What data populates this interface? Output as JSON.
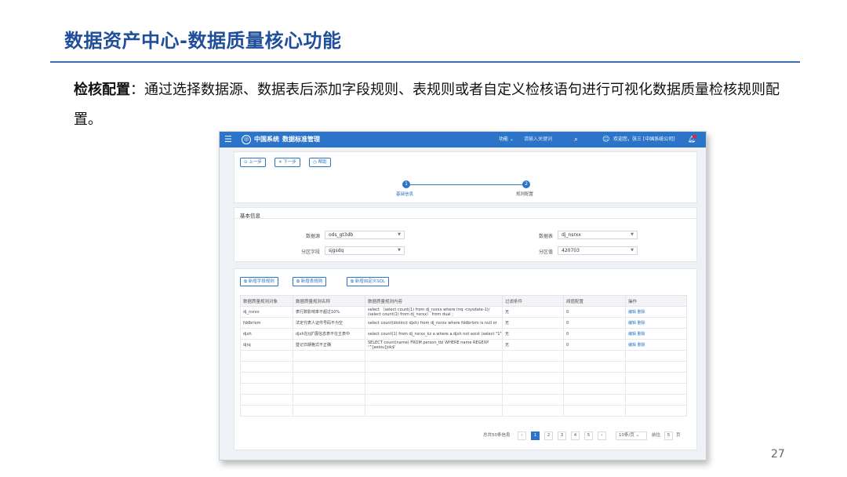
{
  "slide": {
    "title": "数据资产中心-数据质量核心功能",
    "desc_bold": "检核配置",
    "desc_rest": "：通过选择数据源、数据表后添加字段规则、表规则或者自定义检核语句进行可视化数据质量检核规则配置。",
    "page_number": "27"
  },
  "app": {
    "logo_text": "中国系统",
    "module": "数据标准管理",
    "function_menu": "功能",
    "search_placeholder": "请输入关键词",
    "welcome": "欢迎您，张三 [中国系统公司]",
    "accent": "#2b74c8"
  },
  "toolbar": {
    "prev": "上一步",
    "next": "下一步",
    "help": "帮助"
  },
  "steps": [
    {
      "num": "1",
      "label": "基础信息"
    },
    {
      "num": "2",
      "label": "规则配置"
    }
  ],
  "basic_info": {
    "section_title": "基本信息",
    "datasource_label": "数据源",
    "datasource_value": "ods_gt3db",
    "datatable_label": "数据表",
    "datatable_value": "dj_nsrxx",
    "partfield_label": "分区字段",
    "partfield_value": "sjgsdq",
    "partvalue_label": "分区值",
    "partvalue_value": "420703"
  },
  "actions": {
    "add_field_rule": "新增字段规则",
    "add_table_rule": "新增表规则",
    "add_custom_sql": "新增自定义SQL"
  },
  "table": {
    "headers": [
      "数据质量规则对象",
      "数据质量规则名称",
      "数据质量规则内容",
      "过滤条件",
      "阀值配置",
      "操作"
    ],
    "rows": [
      [
        "dj_nsrxx",
        "表行数影响率不超过10%",
        "select （select count(1) from dj_nsrxx where lrrq <sysdate-1)/ (select count(1) from dj_nsrxx） from dual ;",
        "无",
        "0",
        "编辑 删除"
      ],
      [
        "fddbrlxm",
        "法定代表人证件号码不为空",
        "select count(distinct djxh) from dj_nsrxx where fddbrlxm is null or",
        "无",
        "0",
        "编辑 删除"
      ],
      [
        "djxh",
        "djxh在tj扩展信息表不在主表中",
        "select count(1) from dj_nsrxx_kz a where a.djxh not exist (select \"1\")",
        "无",
        "0",
        "编辑 删除"
      ],
      [
        "djrq",
        "登记日期格式不正确",
        "SELECT count(name) FROM person_tbl WHERE name REGEXP '^[aeiou]|ok$'",
        "无",
        "0",
        "编辑 删除"
      ]
    ]
  },
  "pagination": {
    "total": "总共50条信息",
    "pages": [
      "1",
      "2",
      "3",
      "4",
      "5"
    ],
    "page_size": "10条/页",
    "goto_label": "前往",
    "goto_value": "5",
    "page_suffix": "页"
  }
}
